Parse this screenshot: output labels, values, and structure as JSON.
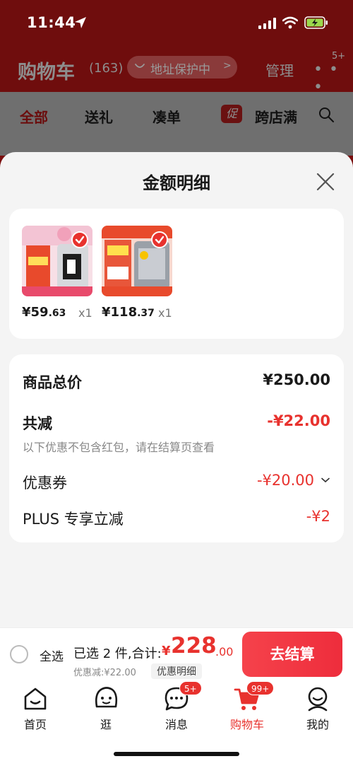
{
  "status_bar": {
    "time": "11:44"
  },
  "header": {
    "title": "购物车",
    "count": "(163)",
    "address_protection": "地址保护中",
    "manage": "管理",
    "more_badge": "5+"
  },
  "tabs": [
    {
      "label": "全部"
    },
    {
      "label": "送礼"
    },
    {
      "label": "凑单"
    },
    {
      "label": "跨店满"
    }
  ],
  "promo_badge": "促",
  "sheet": {
    "title": "金额明细",
    "products": [
      {
        "price_int": "¥59",
        "price_dec": ".63",
        "qty": "x1"
      },
      {
        "price_int": "¥118",
        "price_dec": ".37",
        "qty": "x1"
      }
    ],
    "rows": {
      "total_label": "商品总价",
      "total_value": "¥250.00",
      "reduce_label": "共减",
      "reduce_value": "-¥22.00",
      "note": "以下优惠不包含红包，请在结算页查看",
      "coupon_label": "优惠券",
      "coupon_value": "-¥20.00",
      "plus_label": "PLUS 专享立减",
      "plus_value": "-¥2"
    }
  },
  "checkout": {
    "select_all": "全选",
    "selected_summary": "已选 2 件,合计:",
    "total_symbol": "¥",
    "total_int": "228",
    "total_dec": ".00",
    "discount": "优惠减:¥22.00",
    "detail_link": "优惠明细",
    "pay_button": "去结算"
  },
  "nav": [
    {
      "label": "首页",
      "icon": "home-icon"
    },
    {
      "label": "逛",
      "icon": "browse-face-icon"
    },
    {
      "label": "消息",
      "icon": "message-icon",
      "badge": "5+"
    },
    {
      "label": "购物车",
      "icon": "cart-icon",
      "badge": "99+",
      "active": true
    },
    {
      "label": "我的",
      "icon": "profile-icon"
    }
  ],
  "colors": {
    "accent": "#e8322e",
    "dim_overlay": "#6f0d0d"
  }
}
